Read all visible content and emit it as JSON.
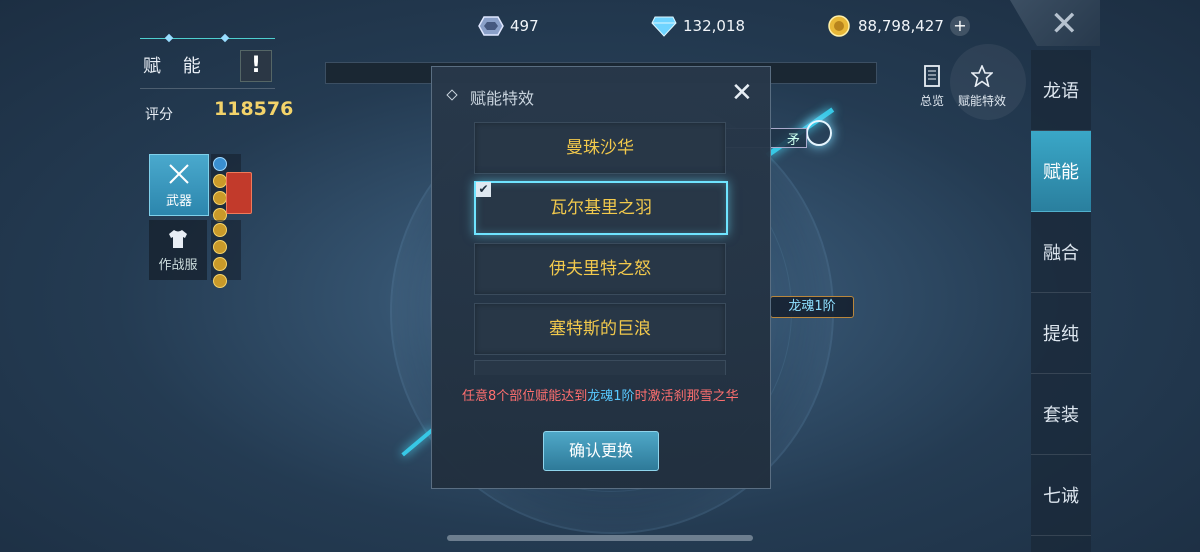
{
  "currencies": [
    {
      "icon": "crystal-icon",
      "value": "497"
    },
    {
      "icon": "diamond-icon",
      "value": "132,018"
    },
    {
      "icon": "gold-coin-icon",
      "value": "88,798,427"
    }
  ],
  "left_panel": {
    "title": "赋 能",
    "warn_label": "!",
    "score_label": "评分",
    "score_value": "118576",
    "slots": {
      "weapon": "武器",
      "suit": "作战服"
    }
  },
  "top_buttons": {
    "overview": "总览",
    "effects": "赋能特效"
  },
  "right_nav": [
    "龙语",
    "赋能",
    "融合",
    "提纯",
    "套装",
    "七诫"
  ],
  "right_nav_active": "赋能",
  "background": {
    "tag_behind": "矛",
    "soul_tag": "龙魂1阶"
  },
  "dialog": {
    "title": "赋能特效",
    "close": "✕",
    "options": [
      "曼珠沙华",
      "瓦尔基里之羽",
      "伊夫里特之怒",
      "塞特斯的巨浪"
    ],
    "selected": "瓦尔基里之羽",
    "check": "✔",
    "hint_a": "任意8个部位赋能达到",
    "hint_b": "龙魂1阶",
    "hint_c": "时激活刹那雪之华",
    "confirm": "确认更换"
  },
  "colors": {
    "accent": "#3aa7c7",
    "gold": "#f2c94c",
    "hint": "#ff6f6f",
    "hint_highlight": "#58c8ff"
  }
}
